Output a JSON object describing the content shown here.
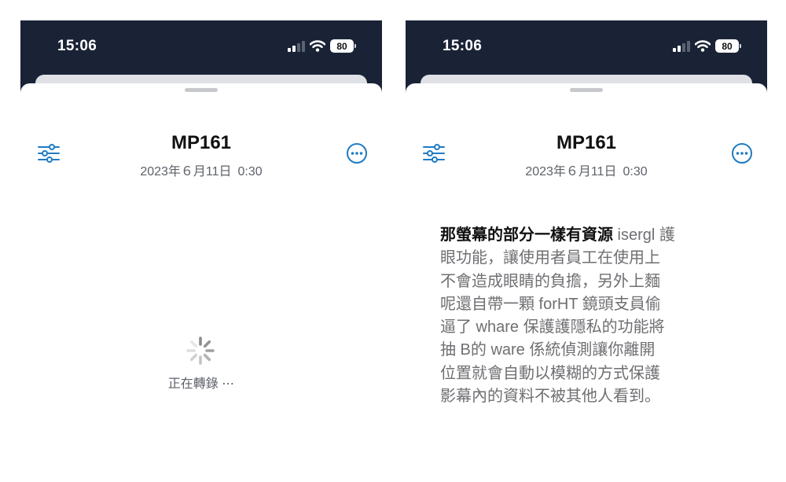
{
  "colors": {
    "status_bar_bg": "#1a2336",
    "accent": "#1f7bc4",
    "transcript_highlight": "#111111",
    "transcript_text": "#6f6f73"
  },
  "screens": [
    {
      "status": {
        "time": "15:06",
        "battery": "80"
      },
      "header": {
        "settings_icon": "sliders-icon",
        "title": "MP161",
        "date": "2023年６月11日",
        "time": "0:30",
        "more_icon": "more-circle-icon"
      },
      "content": {
        "spinner_icon": "spinner-icon",
        "status_text": "正在轉錄 ⋯"
      }
    },
    {
      "status": {
        "time": "15:06",
        "battery": "80"
      },
      "header": {
        "settings_icon": "sliders-icon",
        "title": "MP161",
        "date": "2023年６月11日",
        "time": "0:30",
        "more_icon": "more-circle-icon"
      },
      "transcript": {
        "highlighted": "那螢幕的部分一樣有資源",
        "lines": [
          " isergl 護",
          "眼功能，讓使用者員工在使用上",
          "不會造成眼睛的負擔，另外上麵",
          "呢還自帶一顆 forHT 鏡頭支員偷",
          "逼了 whare 保護護隱私的功能將",
          "抽 B的 ware 係統偵測讓你離開",
          "位置就會自動以模糊的方式保護",
          "影幕內的資料不被其他人看到。"
        ]
      }
    }
  ]
}
